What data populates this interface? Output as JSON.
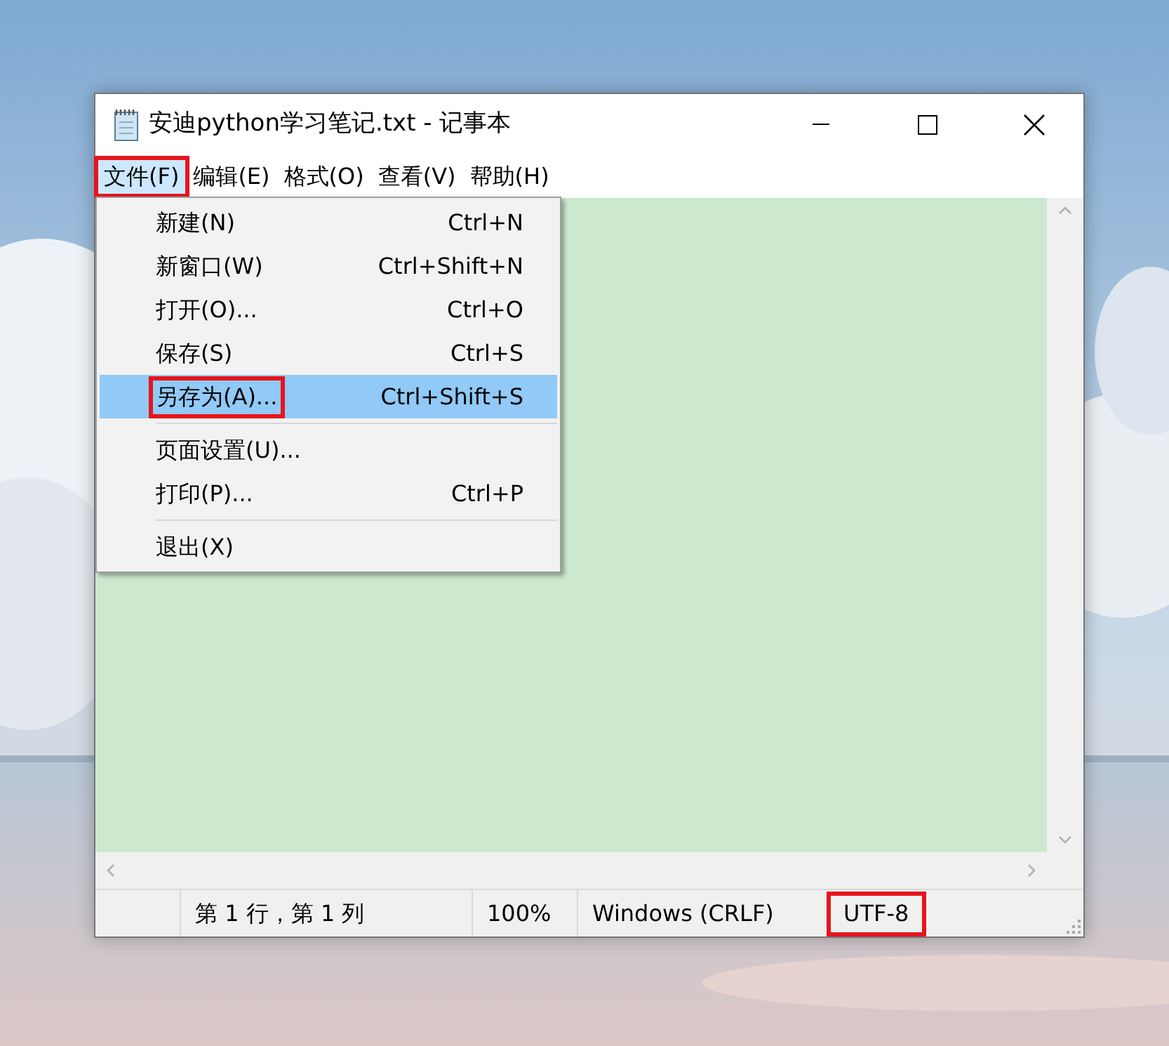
{
  "window": {
    "title": "安迪python学习笔记.txt - 记事本"
  },
  "menu": [
    {
      "label": "文件(F)",
      "selected": true,
      "highlighted": true
    },
    {
      "label": "编辑(E)",
      "selected": false,
      "highlighted": false
    },
    {
      "label": "格式(O)",
      "selected": false,
      "highlighted": false
    },
    {
      "label": "查看(V)",
      "selected": false,
      "highlighted": false
    },
    {
      "label": "帮助(H)",
      "selected": false,
      "highlighted": false
    }
  ],
  "file_menu": [
    {
      "kind": "item",
      "label": "新建(N)",
      "shortcut": "Ctrl+N",
      "selected": false,
      "highlighted": false
    },
    {
      "kind": "item",
      "label": "新窗口(W)",
      "shortcut": "Ctrl+Shift+N",
      "selected": false,
      "highlighted": false
    },
    {
      "kind": "item",
      "label": "打开(O)...",
      "shortcut": "Ctrl+O",
      "selected": false,
      "highlighted": false
    },
    {
      "kind": "item",
      "label": "保存(S)",
      "shortcut": "Ctrl+S",
      "selected": false,
      "highlighted": false
    },
    {
      "kind": "item",
      "label": "另存为(A)...",
      "shortcut": "Ctrl+Shift+S",
      "selected": true,
      "highlighted": true
    },
    {
      "kind": "separator"
    },
    {
      "kind": "item",
      "label": "页面设置(U)...",
      "selected": false,
      "highlighted": false
    },
    {
      "kind": "item",
      "label": "打印(P)...",
      "shortcut": "Ctrl+P",
      "selected": false,
      "highlighted": false
    },
    {
      "kind": "separator"
    },
    {
      "kind": "item",
      "label": "退出(X)",
      "selected": false,
      "highlighted": false
    }
  ],
  "status_bar": [
    {
      "text": "第 1 行，第 1 列",
      "highlighted": false
    },
    {
      "text": "100%",
      "highlighted": false
    },
    {
      "text": "Windows (CRLF)",
      "highlighted": false
    },
    {
      "text": "UTF-8",
      "highlighted": true
    }
  ]
}
